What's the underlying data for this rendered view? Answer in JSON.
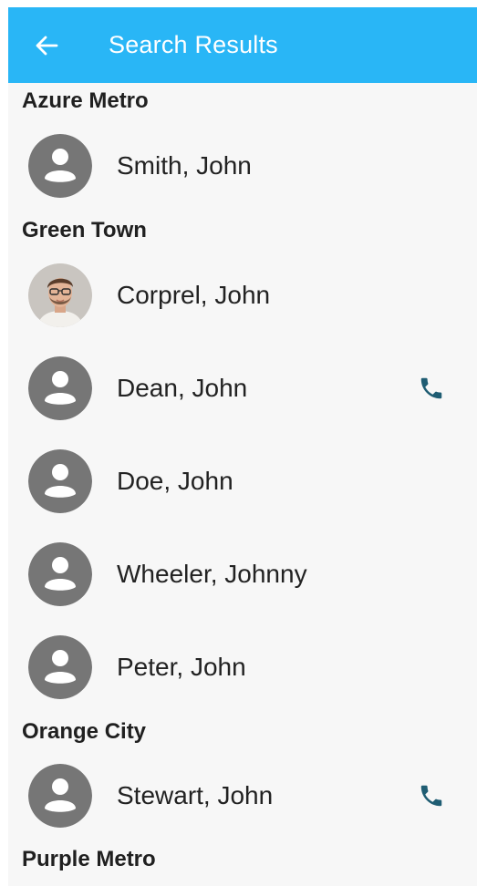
{
  "app_bar": {
    "title": "Search Results",
    "back_icon": "arrow-left-icon",
    "background": "#29b6f6"
  },
  "sections": [
    {
      "header": "Azure Metro",
      "contacts": [
        {
          "name": "Smith, John",
          "avatar": "person-placeholder-icon",
          "has_call": false
        }
      ]
    },
    {
      "header": "Green Town",
      "contacts": [
        {
          "name": "Corprel, John",
          "avatar": "photo",
          "has_call": false
        },
        {
          "name": "Dean, John",
          "avatar": "person-placeholder-icon",
          "has_call": true
        },
        {
          "name": "Doe, John",
          "avatar": "person-placeholder-icon",
          "has_call": false
        },
        {
          "name": "Wheeler, Johnny",
          "avatar": "person-placeholder-icon",
          "has_call": false
        },
        {
          "name": "Peter, John",
          "avatar": "person-placeholder-icon",
          "has_call": false
        }
      ]
    },
    {
      "header": "Orange City",
      "contacts": [
        {
          "name": "Stewart, John",
          "avatar": "person-placeholder-icon",
          "has_call": true
        }
      ]
    },
    {
      "header": "Purple Metro",
      "contacts": []
    }
  ],
  "colors": {
    "accent": "#29b6f6",
    "call_icon": "#1f5d73",
    "avatar_placeholder": "#767676"
  }
}
